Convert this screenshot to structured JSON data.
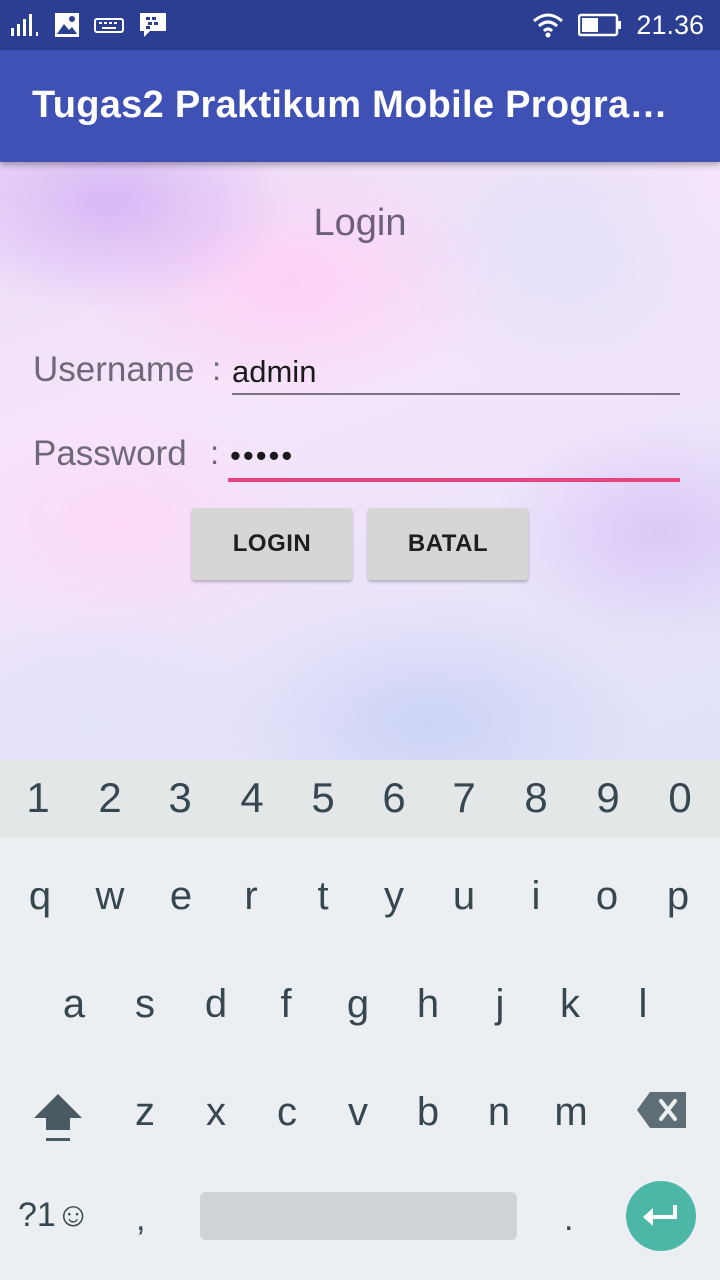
{
  "status_bar": {
    "time": "21.36",
    "icons": [
      "signal-icon",
      "image-icon",
      "keyboard-icon",
      "bbm-icon",
      "wifi-icon",
      "battery-icon"
    ]
  },
  "app_bar": {
    "title": "Tugas2 Praktikum Mobile Progra…",
    "color": "#3f51b5"
  },
  "form": {
    "title": "Login",
    "username_label": "Username",
    "password_label": "Password",
    "colon": ":",
    "username_value": "admin",
    "password_value": "•••••",
    "accent_color": "#e8437e"
  },
  "buttons": {
    "login": "LOGIN",
    "batal": "BATAL"
  },
  "keyboard": {
    "number_row": [
      "1",
      "2",
      "3",
      "4",
      "5",
      "6",
      "7",
      "8",
      "9",
      "0"
    ],
    "row1": [
      "q",
      "w",
      "e",
      "r",
      "t",
      "y",
      "u",
      "i",
      "o",
      "p"
    ],
    "row2": [
      "a",
      "s",
      "d",
      "f",
      "g",
      "h",
      "j",
      "k",
      "l"
    ],
    "row3": [
      "z",
      "x",
      "c",
      "v",
      "b",
      "n",
      "m"
    ],
    "symbols_label": "?1☺",
    "comma": ",",
    "period": ".",
    "enter_color": "#4cb6a7"
  }
}
